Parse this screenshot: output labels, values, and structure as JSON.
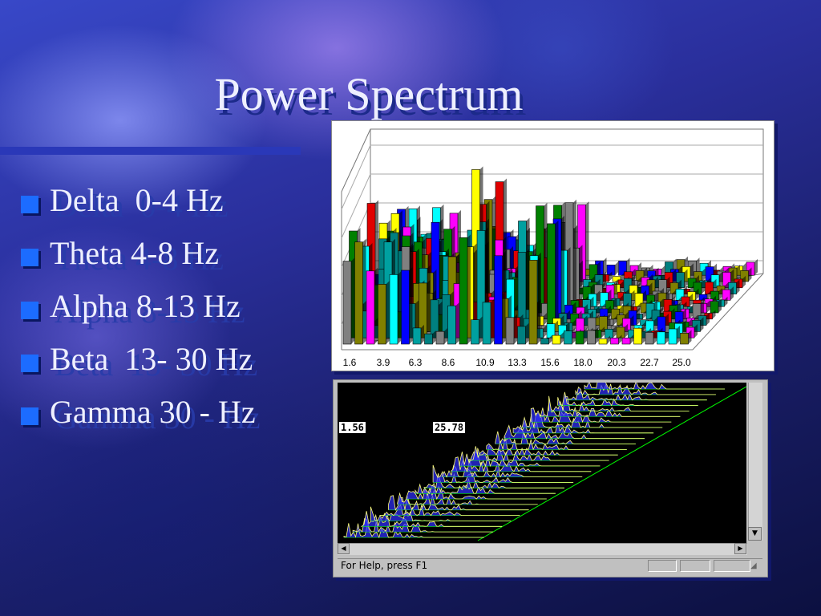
{
  "slide": {
    "title": "Power Spectrum",
    "bullets": [
      "Delta  0-4 Hz",
      "Theta 4-8 Hz",
      "Alpha 8-13 Hz",
      "Beta  13- 30 Hz",
      "Gamma 30 - Hz"
    ]
  },
  "chart3d": {
    "x_tick_labels": [
      "1.6",
      "3.9",
      "6.3",
      "8.6",
      "10.9",
      "13.3",
      "15.6",
      "18.0",
      "20.3",
      "22.7",
      "25.0"
    ],
    "bar_colors": [
      "#008000",
      "#00a0a0",
      "#ff00ff",
      "#e00000",
      "#0000ff",
      "#00ffff",
      "#ffff00",
      "#808080",
      "#008080",
      "#808000"
    ]
  },
  "spectrum_window": {
    "readout_left": "1.56",
    "readout_right": "25.78",
    "trace_colors": [
      "#00ff00",
      "#ffff80",
      "#3030ff"
    ],
    "status_text": "For Help, press F1"
  }
}
